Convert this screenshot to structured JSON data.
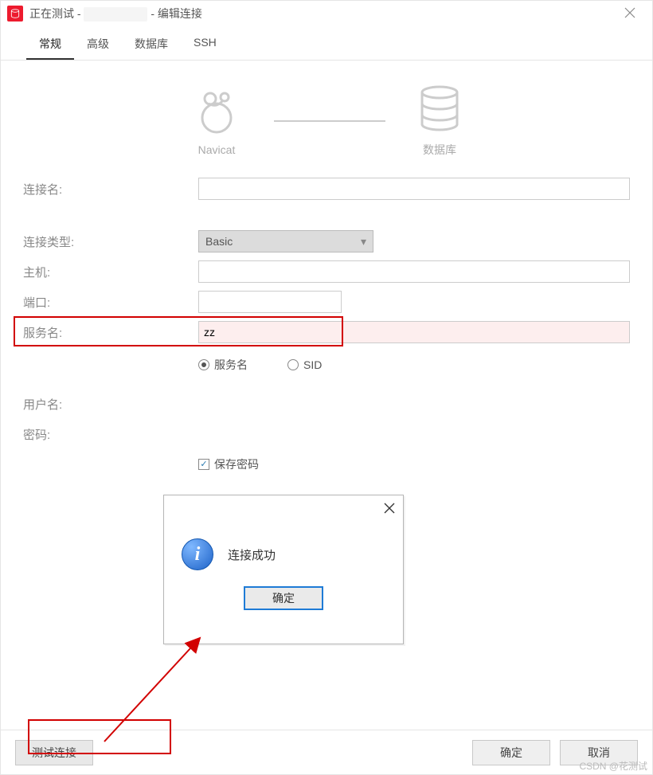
{
  "titlebar": {
    "prefix": "正在测试 - ",
    "suffix": " - 编辑连接"
  },
  "tabs": [
    "常规",
    "高级",
    "数据库",
    "SSH"
  ],
  "hero": {
    "left": "Navicat",
    "right": "数据库"
  },
  "labels": {
    "conn_name": "连接名:",
    "conn_type": "连接类型:",
    "host": "主机:",
    "port": "端口:",
    "service_name": "服务名:",
    "username": "用户名:",
    "password": "密码:"
  },
  "values": {
    "conn_type": "Basic",
    "service_name": "zz",
    "radio_service": "服务名",
    "radio_sid": "SID",
    "save_password": "保存密码"
  },
  "modal": {
    "message": "连接成功",
    "ok": "确定"
  },
  "footer": {
    "test": "测试连接",
    "ok": "确定",
    "cancel": "取消"
  },
  "watermark": "CSDN @花测试"
}
